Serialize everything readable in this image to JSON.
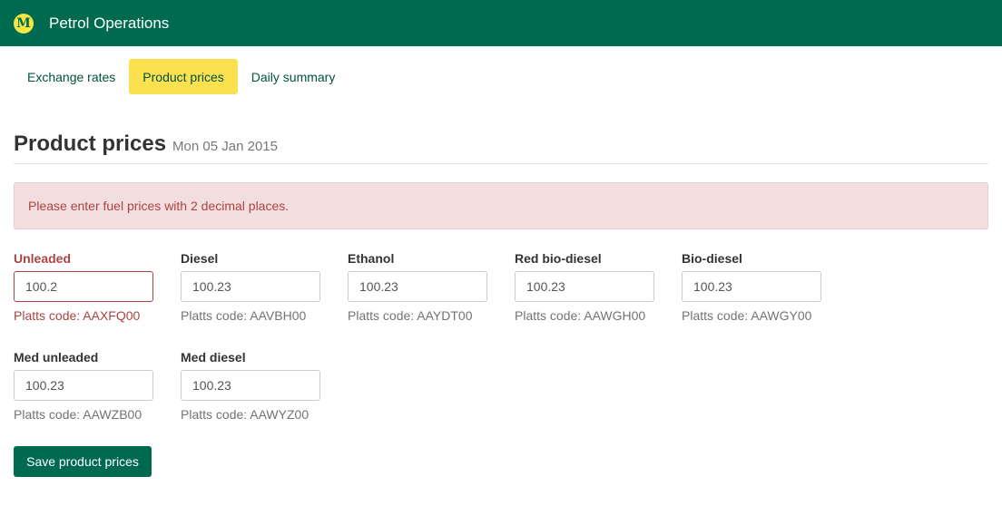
{
  "app": {
    "logo_letter": "M",
    "title": "Petrol Operations",
    "brand_color": "#006a50",
    "accent_color": "#fbe14f"
  },
  "nav": [
    {
      "label": "Exchange rates",
      "active": false
    },
    {
      "label": "Product prices",
      "active": true
    },
    {
      "label": "Daily summary",
      "active": false
    }
  ],
  "page": {
    "title": "Product prices",
    "date": "Mon 05 Jan 2015"
  },
  "alert": {
    "message": "Please enter fuel prices with 2 decimal places.",
    "color": "#a94442"
  },
  "fields": [
    {
      "label": "Unleaded",
      "value": "100.2",
      "platts": "Platts code: AAXFQ00",
      "error": true
    },
    {
      "label": "Diesel",
      "value": "100.23",
      "platts": "Platts code: AAVBH00",
      "error": false
    },
    {
      "label": "Ethanol",
      "value": "100.23",
      "platts": "Platts code: AAYDT00",
      "error": false
    },
    {
      "label": "Red bio-diesel",
      "value": "100.23",
      "platts": "Platts code: AAWGH00",
      "error": false
    },
    {
      "label": "Bio-diesel",
      "value": "100.23",
      "platts": "Platts code: AAWGY00",
      "error": false
    },
    {
      "label": "Med unleaded",
      "value": "100.23",
      "platts": "Platts code: AAWZB00",
      "error": false
    },
    {
      "label": "Med diesel",
      "value": "100.23",
      "platts": "Platts code: AAWYZ00",
      "error": false
    }
  ],
  "actions": {
    "save_label": "Save product prices"
  }
}
